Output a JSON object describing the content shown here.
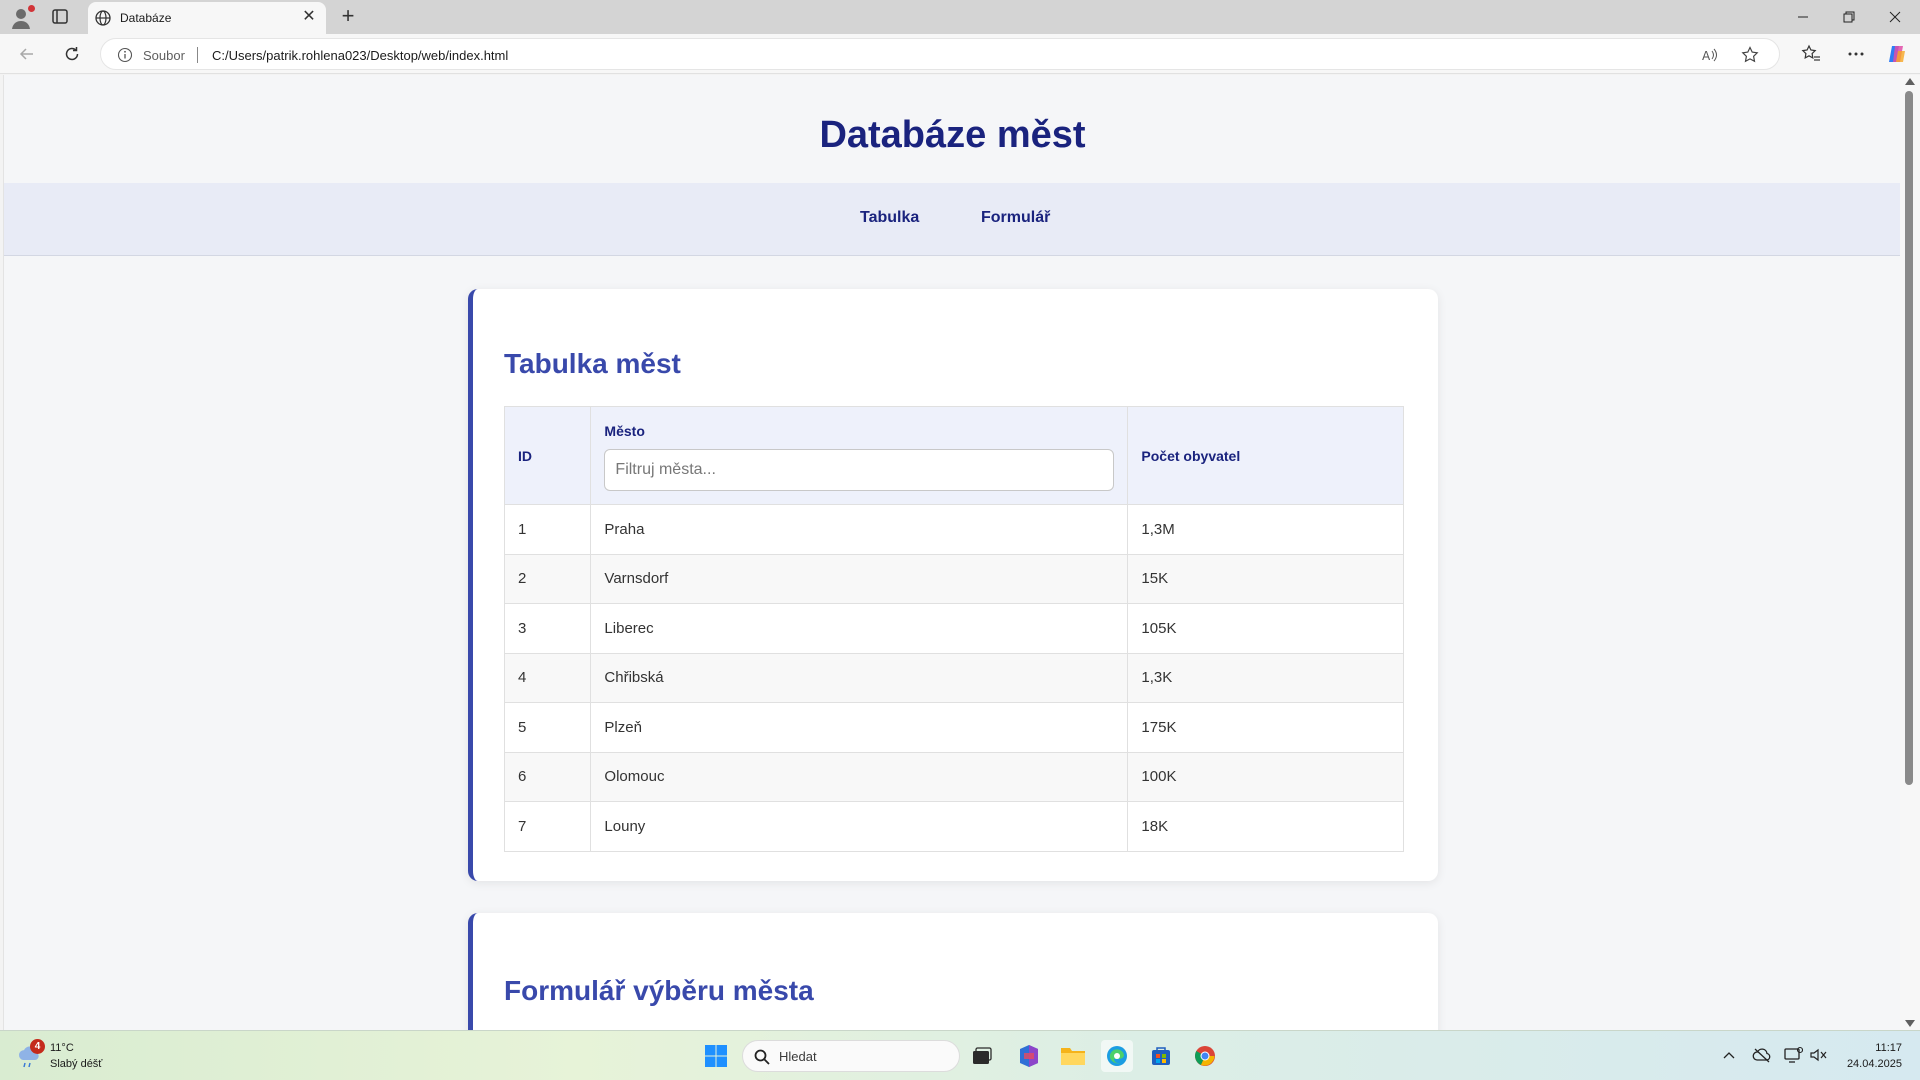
{
  "browser": {
    "tab_title": "Databáze",
    "protocol_label": "Soubor",
    "url": "C:/Users/patrik.rohlena023/Desktop/web/index.html"
  },
  "page": {
    "title": "Databáze měst",
    "nav": [
      {
        "label": "Tabulka"
      },
      {
        "label": "Formulář"
      }
    ]
  },
  "table_section": {
    "title": "Tabulka měst",
    "headers": {
      "id": "ID",
      "city": "Město",
      "population": "Počet obyvatel"
    },
    "filter_placeholder": "Filtruj města...",
    "rows": [
      {
        "id": "1",
        "city": "Praha",
        "population": "1,3M"
      },
      {
        "id": "2",
        "city": "Varnsdorf",
        "population": "15K"
      },
      {
        "id": "3",
        "city": "Liberec",
        "population": "105K"
      },
      {
        "id": "4",
        "city": "Chřibská",
        "population": "1,3K"
      },
      {
        "id": "5",
        "city": "Plzeň",
        "population": "175K"
      },
      {
        "id": "6",
        "city": "Olomouc",
        "population": "100K"
      },
      {
        "id": "7",
        "city": "Louny",
        "population": "18K"
      }
    ]
  },
  "form_section": {
    "title": "Formulář výběru města"
  },
  "taskbar": {
    "weather_badge": "4",
    "temperature": "11°C",
    "condition": "Slabý déšť",
    "search_placeholder": "Hledat",
    "time": "11:17",
    "date": "24.04.2025"
  },
  "colors": {
    "accent": "#3949ab",
    "title": "#1a237e"
  }
}
